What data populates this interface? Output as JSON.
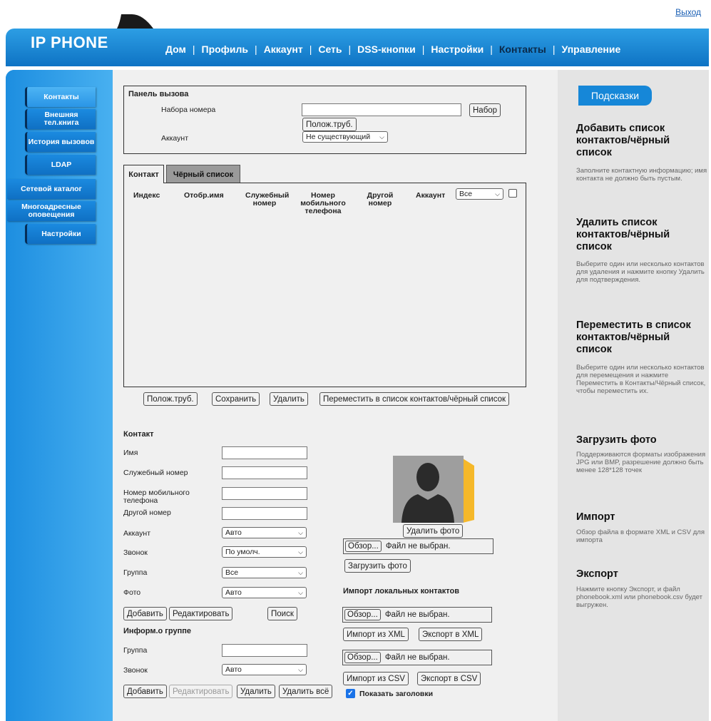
{
  "header": {
    "logout": "Выход",
    "logo": "IP PHONE",
    "nav": [
      "Дом",
      "Профиль",
      "Аккаунт",
      "Сеть",
      "DSS-кнопки",
      "Настройки",
      "Контакты",
      "Управление"
    ],
    "active_nav": "Контакты"
  },
  "sidebar": {
    "items": [
      "Контакты",
      "Внешняя тел.книга",
      "История вызовов",
      "LDAP",
      "Сетевой каталог",
      "Многоадресные оповещения",
      "Настройки"
    ]
  },
  "dial_panel": {
    "title": "Панель вызова",
    "number_label": "Набора номера",
    "number_value": "",
    "dial_button": "Набор",
    "hangup_button": "Полож.труб.",
    "account_label": "Аккаунт",
    "account_value": "Не существующий"
  },
  "contacts_table": {
    "tabs": [
      "Контакт",
      "Чёрный список"
    ],
    "columns": [
      "Индекс",
      "Отобр.имя",
      "Служебный номер",
      "Номер мобильного телефона",
      "Другой номер",
      "Аккаунт"
    ],
    "account_filter": "Все",
    "rows": [],
    "buttons": {
      "hangup": "Полож.труб.",
      "save": "Сохранить",
      "delete": "Удалить",
      "move": "Переместить в список контактов/чёрный список"
    }
  },
  "contact_form": {
    "title": "Контакт",
    "name_label": "Имя",
    "office_label": "Служебный номер",
    "mobile_label": "Номер мобильного телефона",
    "other_label": "Другой номер",
    "account_label": "Аккаунт",
    "account_value": "Авто",
    "ring_label": "Звонок",
    "ring_value": "По умолч.",
    "group_label": "Группа",
    "group_value": "Все",
    "photo_label": "Фото",
    "photo_value": "Авто",
    "add_button": "Добавить",
    "edit_button": "Редактировать",
    "search_button": "Поиск"
  },
  "group_form": {
    "title": "Информ.о группе",
    "group_label": "Группа",
    "ring_label": "Звонок",
    "ring_value": "Авто",
    "add_button": "Добавить",
    "edit_button": "Редактировать",
    "delete_button": "Удалить",
    "delete_all_button": "Удалить всё"
  },
  "photo": {
    "delete_button": "Удалить фото",
    "browse_button": "Обзор...",
    "no_file": "Файл не выбран.",
    "upload_button": "Загрузить фото"
  },
  "import": {
    "title": "Импорт локальных контактов",
    "browse_button": "Обзор...",
    "no_file": "Файл не выбран.",
    "import_xml": "Импорт из XML",
    "export_xml": "Экспорт в XML",
    "import_csv": "Импорт из CSV",
    "export_csv": "Экспорт в CSV",
    "show_headers": "Показать заголовки",
    "show_headers_checked": true
  },
  "tips": {
    "title": "Подсказки",
    "items": [
      {
        "heading": "Добавить список контактов/чёрный список",
        "text": "Заполните контактную информацию; имя контакта не должно быть пустым."
      },
      {
        "heading": "Удалить список контактов/чёрный список",
        "text": "Выберите один или несколько контактов для удаления и нажмите кнопку Удалить для подтверждения."
      },
      {
        "heading": "Переместить в список контактов/чёрный список",
        "text": "Выберите один или несколько контактов для перемещения и нажмите Переместить в Контакты/Чёрный список, чтобы переместить их."
      },
      {
        "heading": "Загрузить фото",
        "text": "Поддерживаются форматы изображения JPG или BMP, разрешение должно быть менее 128*128 точек"
      },
      {
        "heading": "Импорт",
        "text": "Обзор файла в формате XML и CSV для импорта"
      },
      {
        "heading": "Экспорт",
        "text": "Нажмите кнопку Экспорт, и файл phonebook.xml или phonebook.csv будет выгружен."
      }
    ]
  }
}
